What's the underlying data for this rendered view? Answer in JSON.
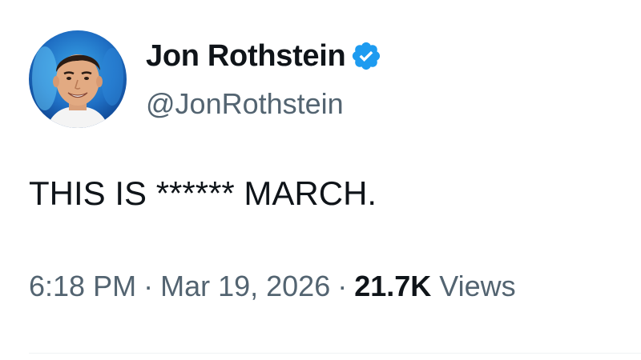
{
  "tweet": {
    "author": {
      "display_name": "Jon Rothstein",
      "handle": "@JonRothstein",
      "verified": true,
      "verified_icon": "verified-badge-icon",
      "verified_color": "#1d9bf0",
      "avatar": "profile-photo"
    },
    "text": "THIS IS ****** MARCH.",
    "meta": {
      "time": "6:18 PM",
      "separator": "·",
      "date": "Mar 19, 2026",
      "views_count": "21.7K",
      "views_label": "Views"
    }
  },
  "colors": {
    "primary_text": "#0f1419",
    "secondary_text": "#536471",
    "accent": "#1d9bf0",
    "divider": "#eff3f4",
    "background": "#ffffff"
  }
}
